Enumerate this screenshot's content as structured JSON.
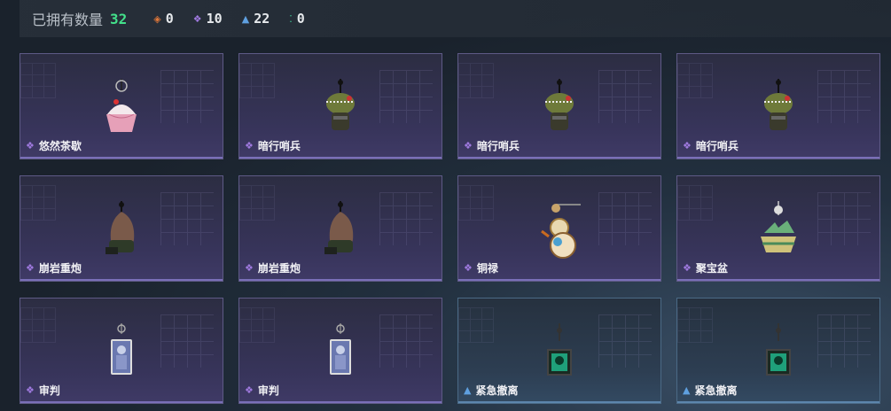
{
  "header": {
    "title": "已拥有数量",
    "count": "32",
    "stats": [
      {
        "icon": "orange-diamond-icon",
        "glyph": "◈",
        "color": "#e0783a",
        "value": "0"
      },
      {
        "icon": "purple-diamond-icon",
        "glyph": "❖",
        "color": "#a07ae0",
        "value": "10"
      },
      {
        "icon": "blue-chevron-icon",
        "glyph": "▲",
        "color": "#5fa0e0",
        "value": "22"
      },
      {
        "icon": "green-dots-icon",
        "glyph": "⁚",
        "color": "#3fd29a",
        "value": "0"
      }
    ]
  },
  "colors": {
    "purple": "#a07ae0",
    "blue": "#5fa0e0"
  },
  "items": [
    {
      "name": "悠然茶歇",
      "rarity": "purple",
      "art": "cupcake"
    },
    {
      "name": "暗行哨兵",
      "rarity": "purple",
      "art": "croc"
    },
    {
      "name": "暗行哨兵",
      "rarity": "purple",
      "art": "croc"
    },
    {
      "name": "暗行哨兵",
      "rarity": "purple",
      "art": "croc"
    },
    {
      "name": "崩岩重炮",
      "rarity": "purple",
      "art": "bean"
    },
    {
      "name": "崩岩重炮",
      "rarity": "purple",
      "art": "bean"
    },
    {
      "name": "铜禄",
      "rarity": "purple",
      "art": "gourd"
    },
    {
      "name": "聚宝盆",
      "rarity": "purple",
      "art": "bowl"
    },
    {
      "name": "审判",
      "rarity": "purple",
      "art": "card"
    },
    {
      "name": "审判",
      "rarity": "purple",
      "art": "card"
    },
    {
      "name": "紧急撤离",
      "rarity": "blue",
      "art": "tag"
    },
    {
      "name": "紧急撤离",
      "rarity": "blue",
      "art": "tag"
    }
  ]
}
